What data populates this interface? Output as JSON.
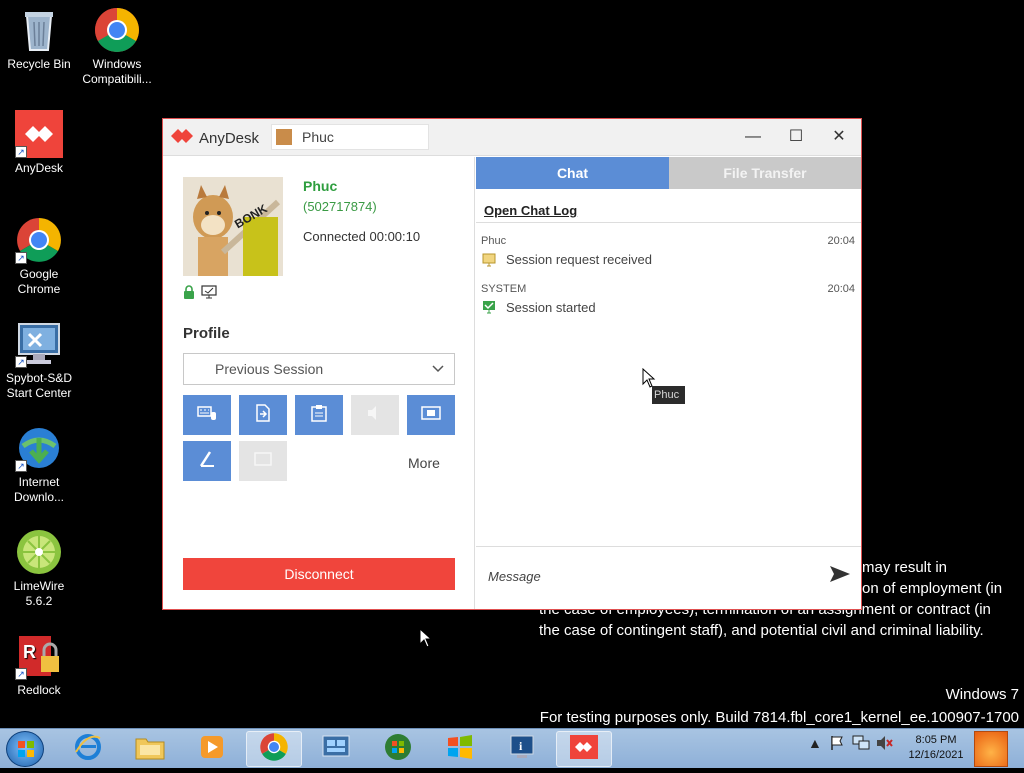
{
  "desktop": {
    "icons": [
      {
        "label": "Recycle Bin",
        "icon": "recycle-bin-icon"
      },
      {
        "label": "Windows Compatibili...",
        "icon": "chrome-icon"
      },
      {
        "label": "AnyDesk",
        "icon": "anydesk-icon"
      },
      {
        "label": "Google Chrome",
        "icon": "chrome-icon"
      },
      {
        "label": "Spybot-S&D Start Center",
        "icon": "spybot-icon"
      },
      {
        "label": "Internet Downlo...",
        "icon": "idm-icon"
      },
      {
        "label": "LimeWire 5.6.2",
        "icon": "limewire-icon"
      },
      {
        "label": "Redlock",
        "icon": "redlock-icon"
      }
    ],
    "background_text": {
      "line1": "may result in",
      "line2": "on of employment (in",
      "line3": "the case of employees), termination of an assignment or contract (in",
      "line4": "the case of contingent staff), and potential civil and criminal liability.",
      "os_name": "Windows 7",
      "build": "For testing purposes only. Build 7814.fbl_core1_kernel_ee.100907-1700"
    }
  },
  "window": {
    "app_name": "AnyDesk",
    "tab_label": "Phuc",
    "controls": {
      "minimize": "—",
      "maximize": "☐",
      "close": "✕"
    },
    "left": {
      "peer_name": "Phuc",
      "peer_id": "(502717874)",
      "status": "Connected 00:00:10",
      "avatar_text": "BONK",
      "profile_label": "Profile",
      "profile_value": "Previous Session",
      "more_label": "More",
      "disconnect_label": "Disconnect",
      "tools": [
        {
          "icon": "keyboard-mouse-icon",
          "enabled": true
        },
        {
          "icon": "file-send-icon",
          "enabled": true
        },
        {
          "icon": "clipboard-icon",
          "enabled": true
        },
        {
          "icon": "audio-icon",
          "enabled": false
        },
        {
          "icon": "record-icon",
          "enabled": true
        },
        {
          "icon": "draw-icon",
          "enabled": true
        },
        {
          "icon": "screen-icon",
          "enabled": false
        }
      ]
    },
    "right": {
      "tab_chat": "Chat",
      "tab_files": "File Transfer",
      "open_log": "Open Chat Log",
      "messages": [
        {
          "sender": "Phuc",
          "time": "20:04",
          "text": "Session request received"
        },
        {
          "sender": "SYSTEM",
          "time": "20:04",
          "text": "Session started"
        }
      ],
      "message_placeholder": "Message"
    }
  },
  "cursor_label": "Phuc",
  "taskbar": {
    "clock_time": "8:05 PM",
    "clock_date": "12/16/2021"
  },
  "colors": {
    "accent_blue": "#5b8dd6",
    "disconnect_red": "#f0453c",
    "peer_green": "#2f9e3f"
  }
}
